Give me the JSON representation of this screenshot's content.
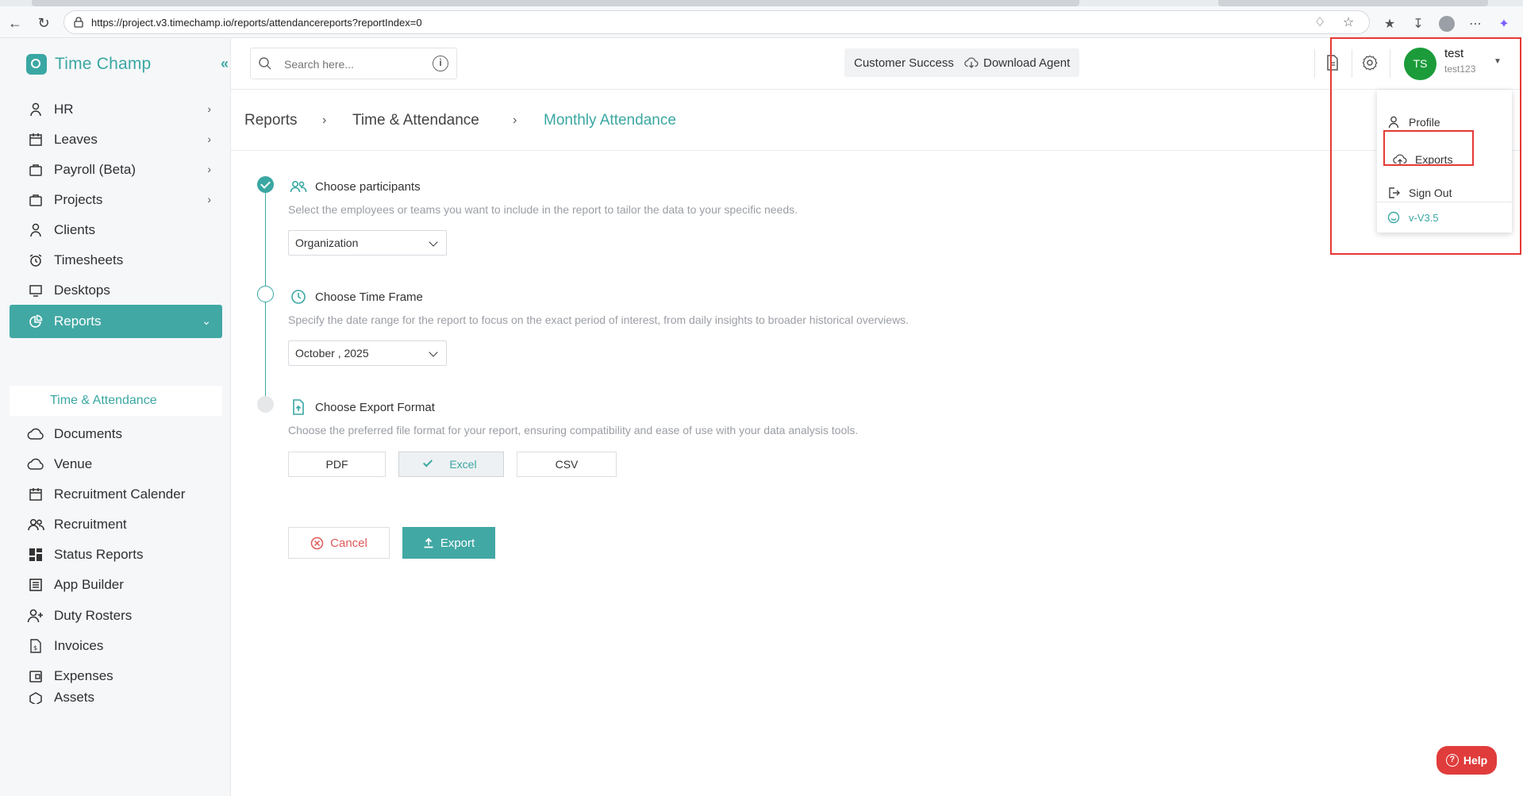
{
  "browser": {
    "url": "https://project.v3.timechamp.io/reports/attendancereports?reportIndex=0"
  },
  "brand": {
    "name": "Time Champ"
  },
  "sidebar": {
    "items": [
      {
        "label": "HR",
        "icon": "person-icon",
        "chevron": true
      },
      {
        "label": "Leaves",
        "icon": "calendar-icon",
        "chevron": true
      },
      {
        "label": "Payroll (Beta)",
        "icon": "briefcase-icon",
        "chevron": true
      },
      {
        "label": "Projects",
        "icon": "briefcase-icon",
        "chevron": true
      },
      {
        "label": "Clients",
        "icon": "person-icon",
        "chevron": false
      },
      {
        "label": "Timesheets",
        "icon": "alarm-clock-icon",
        "chevron": false
      },
      {
        "label": "Desktops",
        "icon": "monitor-icon",
        "chevron": false
      },
      {
        "label": "Reports",
        "icon": "pie-chart-icon",
        "chevron": true,
        "active": true
      },
      {
        "label": "Documents",
        "icon": "cloud-icon",
        "chevron": false
      },
      {
        "label": "Venue",
        "icon": "cloud-icon",
        "chevron": false
      },
      {
        "label": "Recruitment Calender",
        "icon": "calendar-icon",
        "chevron": false
      },
      {
        "label": "Recruitment",
        "icon": "group-icon",
        "chevron": false
      },
      {
        "label": "Status Reports",
        "icon": "dashboard-icon",
        "chevron": false
      },
      {
        "label": "App Builder",
        "icon": "list-icon",
        "chevron": false
      },
      {
        "label": "Duty Rosters",
        "icon": "person-add-icon",
        "chevron": false
      },
      {
        "label": "Invoices",
        "icon": "document-icon",
        "chevron": false
      },
      {
        "label": "Expenses",
        "icon": "wallet-icon",
        "chevron": false
      },
      {
        "label": "Assets",
        "icon": "box-icon",
        "chevron": false
      }
    ],
    "sub_item": "Time & Attendance"
  },
  "header": {
    "search_placeholder": "Search here...",
    "customer_success": "Customer Success",
    "download_agent": "Download Agent",
    "user_initials": "TS",
    "user_name": "test",
    "user_handle": "test123"
  },
  "breadcrumb": {
    "items": [
      "Reports",
      "Time & Attendance",
      "Monthly Attendance"
    ]
  },
  "steps": {
    "participants": {
      "title": "Choose participants",
      "desc": "Select the employees or teams you want to include in the report to tailor the data to your specific needs.",
      "value": "Organization"
    },
    "time_frame": {
      "title": "Choose Time Frame",
      "desc": "Specify the date range for the report to focus on the exact period of interest, from daily insights to broader historical overviews.",
      "value": "October , 2025"
    },
    "export_format": {
      "title": "Choose Export Format",
      "desc": "Choose the preferred file format for your report, ensuring compatibility and ease of use with your data analysis tools.",
      "options": [
        "PDF",
        "Excel",
        "CSV"
      ],
      "selected": "Excel"
    }
  },
  "actions": {
    "cancel": "Cancel",
    "export": "Export"
  },
  "user_menu": {
    "items": [
      "Profile",
      "Exports",
      "Sign Out"
    ],
    "version": "v-V3.5"
  },
  "help": {
    "label": "Help"
  },
  "colors": {
    "accent": "#42a8a4",
    "danger": "#e53935",
    "avatar": "#1b9b3a"
  }
}
